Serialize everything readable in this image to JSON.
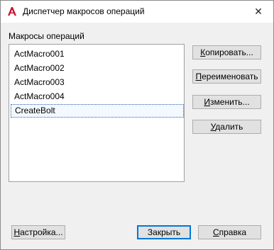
{
  "window": {
    "title": "Диспетчер макросов операций",
    "app_icon": "autocad-a-icon",
    "close_icon": "close-icon",
    "close_glyph": "✕"
  },
  "macros": {
    "label": "Макросы операций",
    "items": [
      "ActMacro001",
      "ActMacro002",
      "ActMacro003",
      "ActMacro004",
      "CreateBolt"
    ],
    "selected": "CreateBolt"
  },
  "buttons": {
    "copy": {
      "mnemonic": "К",
      "rest": "опировать..."
    },
    "rename": {
      "mnemonic": "П",
      "rest": "ереименовать"
    },
    "edit": {
      "mnemonic": "И",
      "rest": "зменить..."
    },
    "delete": {
      "mnemonic": "У",
      "rest": "далить"
    },
    "settings": {
      "mnemonic": "Н",
      "rest": "астройка..."
    },
    "close": {
      "label": "Закрыть"
    },
    "help": {
      "mnemonic": "С",
      "rest": "правка"
    }
  },
  "colors": {
    "accent": "#0078d7",
    "app_icon": "#c8102e"
  }
}
